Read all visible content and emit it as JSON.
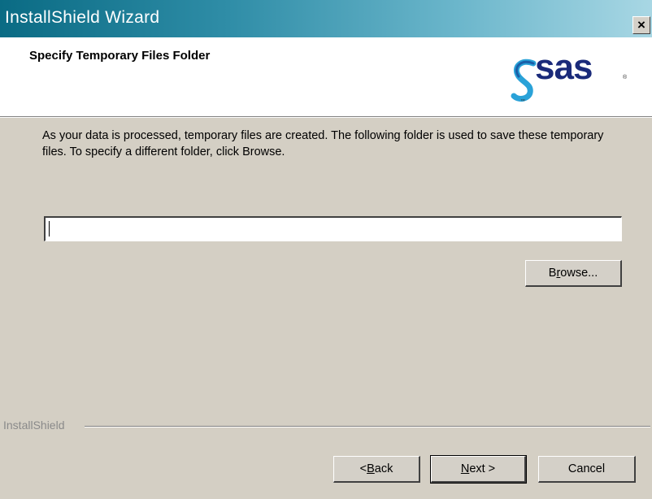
{
  "window": {
    "title": "InstallShield Wizard",
    "close_symbol": "×"
  },
  "header": {
    "title": "Specify Temporary Files Folder",
    "logo": {
      "text": "sas",
      "tm": "™",
      "registered": "®",
      "icon": "sas-logo-icon",
      "color": "#1a2a7a"
    }
  },
  "body": {
    "description": "As your data is processed, temporary files are created.  The following folder is used to save these temporary files.  To specify a different folder, click Browse.",
    "path_value": "",
    "browse": {
      "pre": "B",
      "accel": "r",
      "post": "owse..."
    }
  },
  "footer": {
    "brand": "InstallShield",
    "back": {
      "pre": "< ",
      "accel": "B",
      "post": "ack"
    },
    "next": {
      "pre": "",
      "accel": "N",
      "post": "ext >"
    },
    "cancel": "Cancel"
  },
  "colors": {
    "titlebar_start": "#0a6b84",
    "titlebar_end": "#a8d7e4",
    "dialog_bg": "#d4cfc4"
  }
}
